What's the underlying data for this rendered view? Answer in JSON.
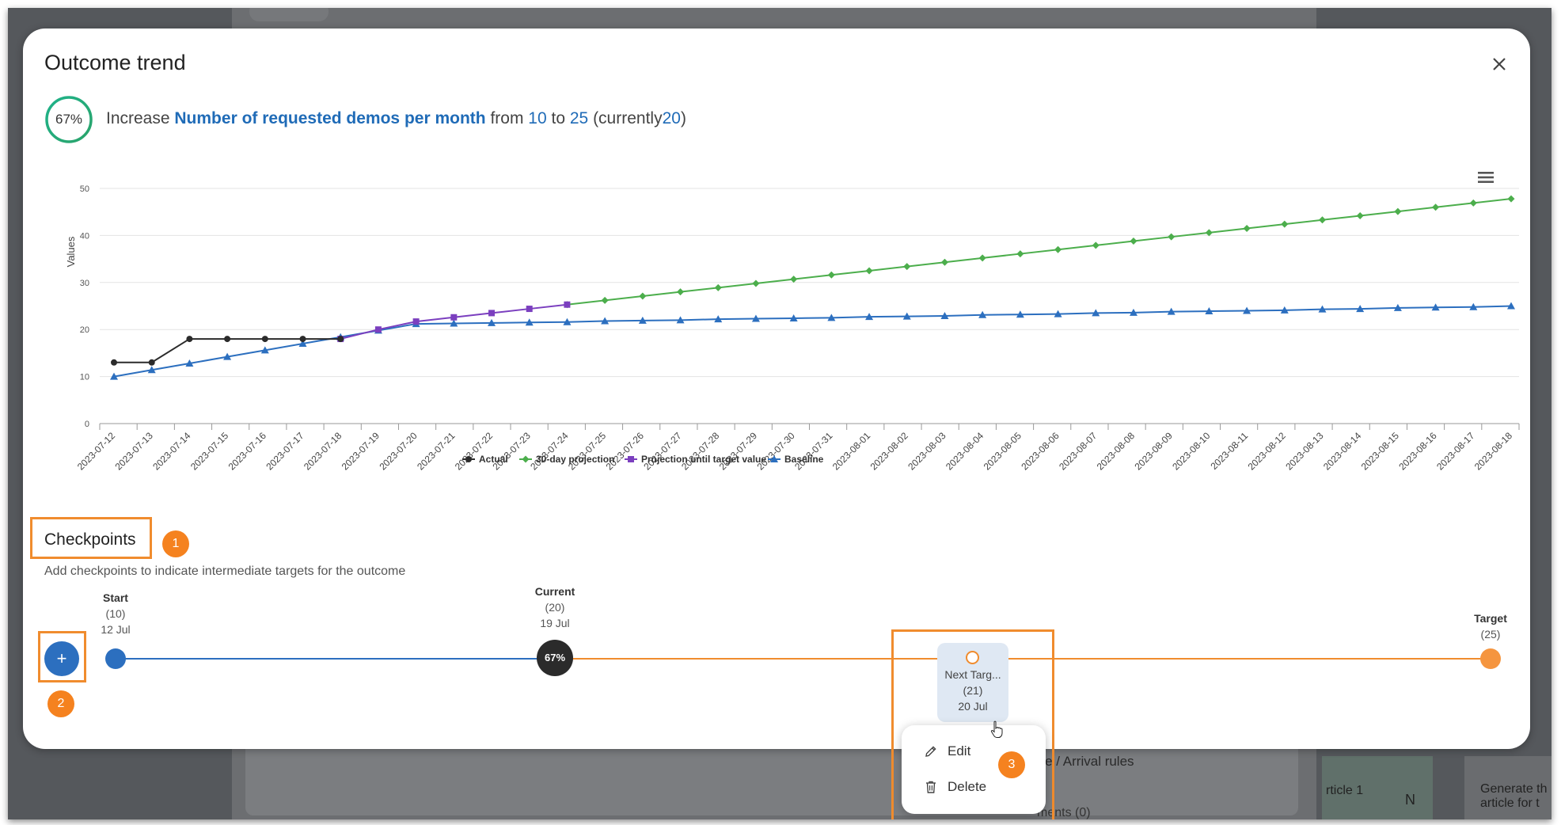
{
  "modal": {
    "title": "Outcome trend",
    "close_icon": "close-icon"
  },
  "outcome": {
    "progress_percent": 67,
    "progress_label": "67%",
    "prefix": "Increase",
    "metric": "Number of requested demos per month",
    "from_word": "from",
    "from_value": "10",
    "to_word": "to",
    "to_value": "25",
    "current_prefix": "(currently",
    "current_value": "20",
    "current_suffix": ")"
  },
  "chart_data": {
    "type": "line",
    "ylabel": "Values",
    "ylim": [
      0,
      50
    ],
    "yticks": [
      0,
      10,
      20,
      30,
      40,
      50
    ],
    "x": [
      "2023-07-12",
      "2023-07-13",
      "2023-07-14",
      "2023-07-15",
      "2023-07-16",
      "2023-07-17",
      "2023-07-18",
      "2023-07-19",
      "2023-07-20",
      "2023-07-21",
      "2023-07-22",
      "2023-07-23",
      "2023-07-24",
      "2023-07-25",
      "2023-07-26",
      "2023-07-27",
      "2023-07-28",
      "2023-07-29",
      "2023-07-30",
      "2023-07-31",
      "2023-08-01",
      "2023-08-02",
      "2023-08-03",
      "2023-08-04",
      "2023-08-05",
      "2023-08-06",
      "2023-08-07",
      "2023-08-08",
      "2023-08-09",
      "2023-08-10",
      "2023-08-11",
      "2023-08-12",
      "2023-08-13",
      "2023-08-14",
      "2023-08-15",
      "2023-08-16",
      "2023-08-17",
      "2023-08-18"
    ],
    "grid": true,
    "legend": "bottom",
    "series": [
      {
        "name": "Actual",
        "color": "#2b2b2b",
        "marker": "circle",
        "start_index": 0,
        "values": [
          13,
          13,
          18,
          18,
          18,
          18,
          18
        ]
      },
      {
        "name": "30-day projection",
        "color": "#4cae4c",
        "marker": "diamond",
        "start_index": 12,
        "values": [
          25.3,
          26.2,
          27.1,
          28.0,
          28.9,
          29.8,
          30.7,
          31.6,
          32.5,
          33.4,
          34.3,
          35.2,
          36.1,
          37.0,
          37.9,
          38.8,
          39.7,
          40.6,
          41.5,
          42.4,
          43.3,
          44.2,
          45.1,
          46.0,
          46.9,
          47.8
        ]
      },
      {
        "name": "Projection until target value",
        "color": "#7b3fbf",
        "marker": "square",
        "start_index": 6,
        "values": [
          18,
          20.0,
          21.7,
          22.6,
          23.5,
          24.4,
          25.3
        ]
      },
      {
        "name": "Baseline",
        "color": "#2c6fbf",
        "marker": "triangle",
        "start_index": 0,
        "values": [
          10.0,
          11.4,
          12.8,
          14.2,
          15.6,
          17.0,
          18.4,
          19.8,
          21.2,
          21.3,
          21.4,
          21.5,
          21.6,
          21.8,
          21.9,
          22.0,
          22.2,
          22.3,
          22.4,
          22.5,
          22.7,
          22.8,
          22.9,
          23.1,
          23.2,
          23.3,
          23.5,
          23.6,
          23.8,
          23.9,
          24.0,
          24.1,
          24.3,
          24.4,
          24.6,
          24.7,
          24.8,
          25.0
        ]
      }
    ]
  },
  "checkpoints": {
    "title": "Checkpoints",
    "description": "Add checkpoints to indicate intermediate targets for the outcome",
    "add_label": "+",
    "start": {
      "name": "Start",
      "value": "(10)",
      "date": "12 Jul"
    },
    "current": {
      "name": "Current",
      "value": "(20)",
      "date": "19 Jul",
      "percent": "67%"
    },
    "next": {
      "name": "Next Targ...",
      "value": "(21)",
      "date": "20 Jul"
    },
    "target": {
      "name": "Target",
      "value": "(25)"
    }
  },
  "context_menu": {
    "edit_label": "Edit",
    "delete_label": "Delete"
  },
  "annotations": {
    "badge1": "1",
    "badge2": "2",
    "badge3": "3"
  },
  "background": {
    "arrival_rules": "ure / Arrival rules",
    "article": "rticle 1",
    "n_value": "N",
    "generate": "Generate th",
    "article_for": "article for t",
    "ments": "ments (0)"
  }
}
